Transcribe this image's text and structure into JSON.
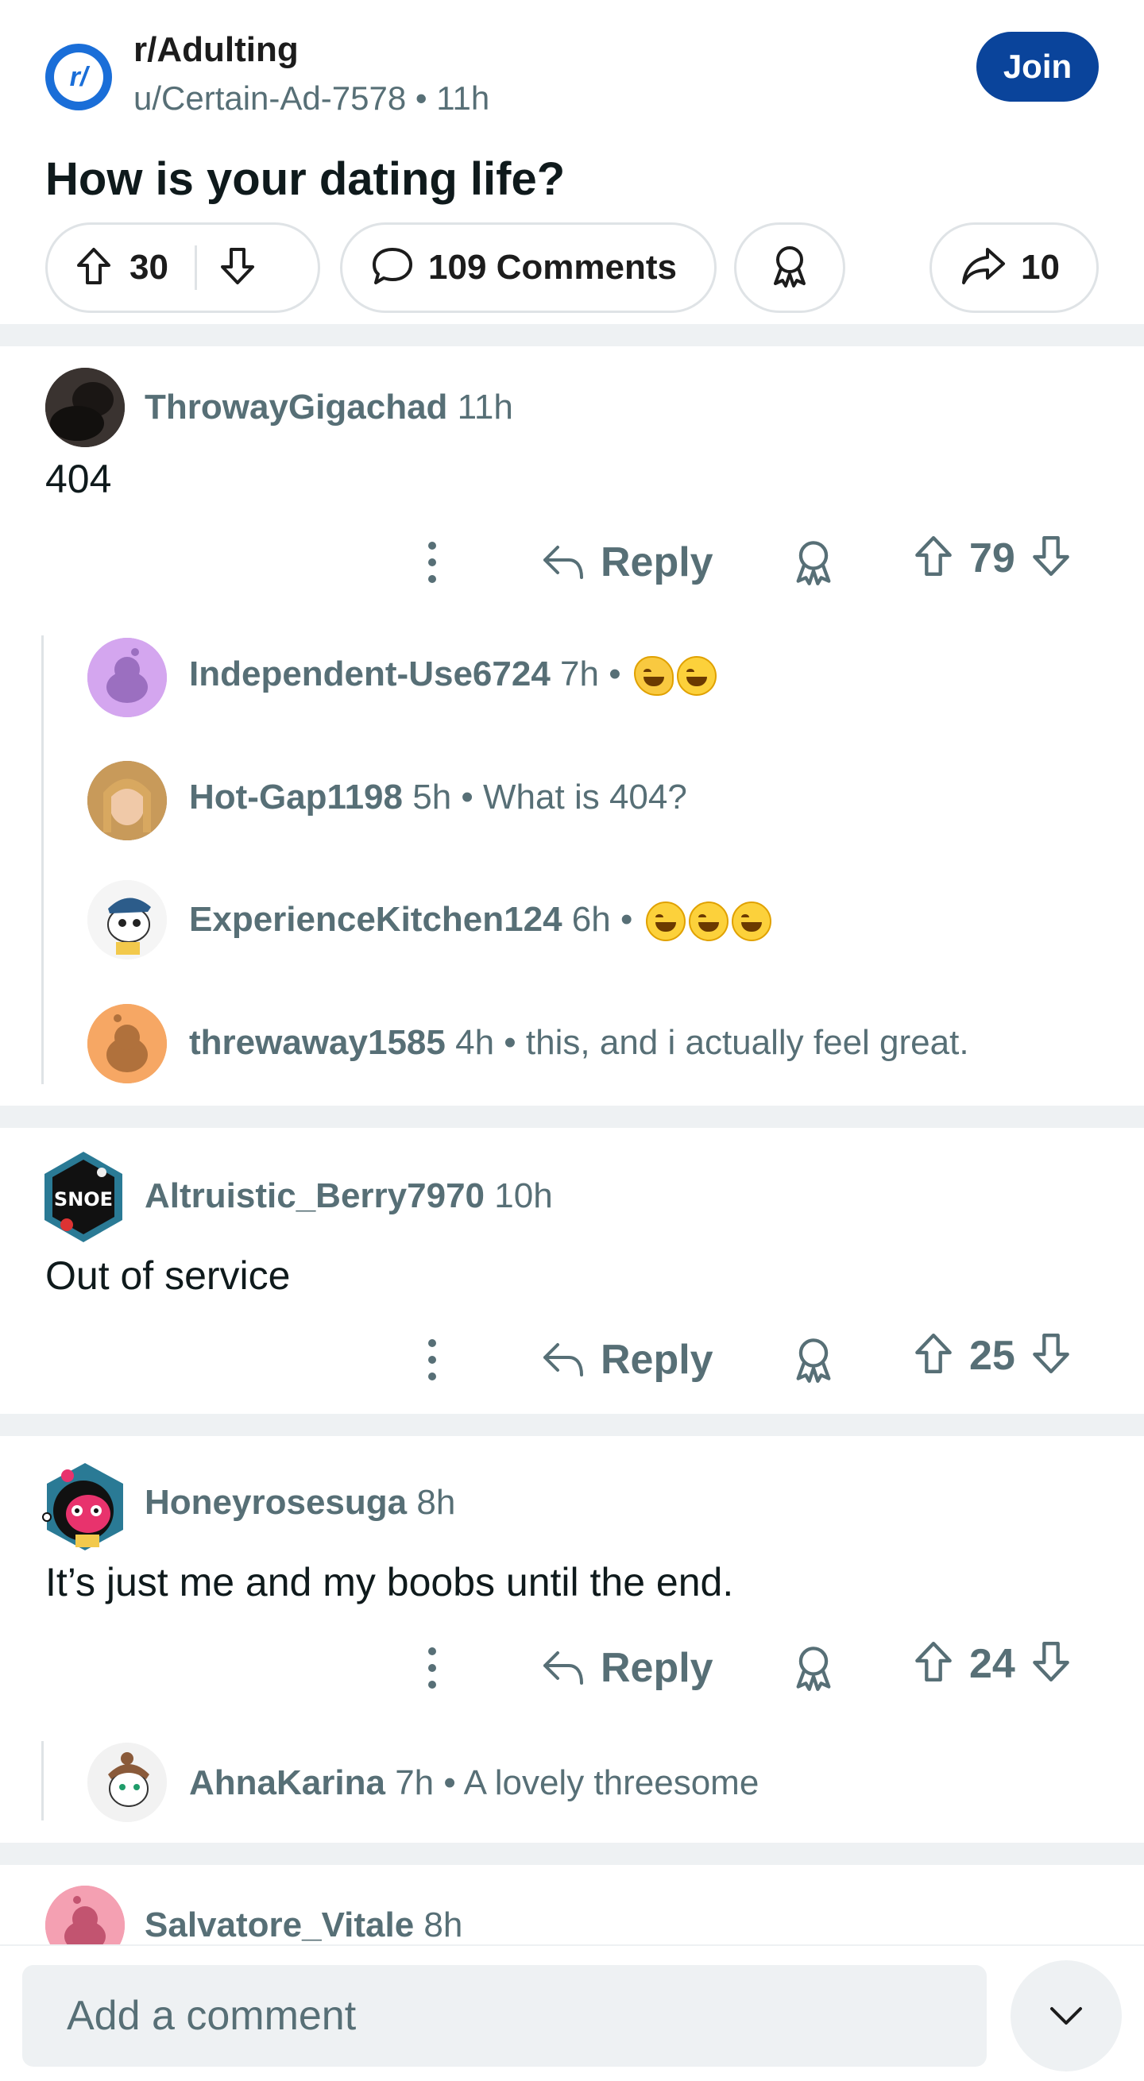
{
  "post": {
    "subreddit_icon": "r/",
    "subreddit": "r/Adulting",
    "meta": "u/Certain-Ad-7578 • 11h",
    "join_label": "Join",
    "title": "How is your dating life?",
    "votes": "30",
    "comments_label": "109 Comments",
    "shares": "10"
  },
  "colors": {
    "join_bg": "#0a449b",
    "subreddit_icon": "#1a6ed8",
    "muted_text": "#576f76",
    "divider": "#eef1f3"
  },
  "comments": [
    {
      "username": "ThrowayGigachad",
      "time": "11h",
      "body": "404",
      "reply_label": "Reply",
      "votes": "79",
      "replies": [
        {
          "username": "Independent-Use6724",
          "meta": "7h •",
          "text": ""
        },
        {
          "username": "Hot-Gap1198",
          "meta": "5h •",
          "text": "What is 404?"
        },
        {
          "username": "ExperienceKitchen124",
          "meta": "6h •",
          "text": ""
        },
        {
          "username": "threwaway1585",
          "meta": "4h •",
          "text": "this, and i actually feel great."
        }
      ]
    },
    {
      "username": "Altruistic_Berry7970",
      "time": "10h",
      "body": "Out of service",
      "reply_label": "Reply",
      "votes": "25"
    },
    {
      "username": "Honeyrosesuga",
      "time": "8h",
      "body": "It’s just me and my boobs until the end.",
      "reply_label": "Reply",
      "votes": "24",
      "replies": [
        {
          "username": "AhnaKarina",
          "meta": "7h •",
          "text": "A lovely threesome"
        }
      ]
    },
    {
      "username": "Salvatore_Vitale",
      "time": "8h"
    }
  ],
  "composer": {
    "placeholder": "Add a comment"
  }
}
